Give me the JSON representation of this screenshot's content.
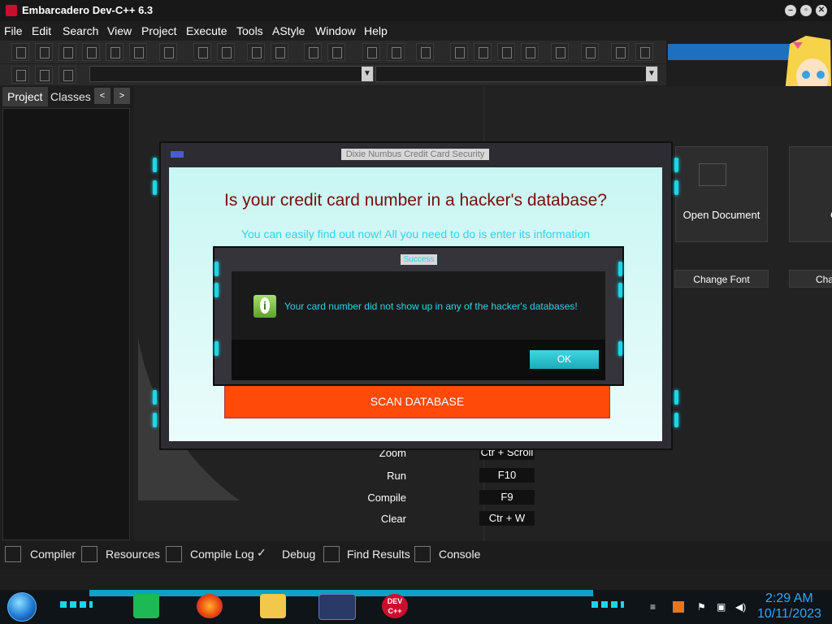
{
  "window": {
    "title": "Embarcadero Dev-C++ 6.3",
    "controls": [
      "minimize",
      "restore",
      "close"
    ]
  },
  "menu": [
    "File",
    "Edit",
    "Search",
    "View",
    "Project",
    "Execute",
    "Tools",
    "AStyle",
    "Window",
    "Help"
  ],
  "toolbar": {
    "search_value": ""
  },
  "left_tabs": {
    "project": "Project",
    "classes": "Classes",
    "prev": "<",
    "next": ">"
  },
  "welcome": {
    "open_document": "Open Document",
    "change_font": "Change Font",
    "partial_card": "C",
    "partial_button": "Cha",
    "shortcuts": [
      {
        "label": "Zoom",
        "key": "Ctr + Scroll"
      },
      {
        "label": "Run",
        "key": "F10"
      },
      {
        "label": "Compile",
        "key": "F9"
      },
      {
        "label": "Clear",
        "key": "Ctr + W"
      }
    ]
  },
  "bottom_tabs": [
    "Compiler",
    "Resources",
    "Compile Log",
    "Debug",
    "Find Results",
    "Console"
  ],
  "dialog_main": {
    "title": "Dixie Numbus Credit Card Security",
    "heading": "Is your credit card number in a hacker's database?",
    "subheading": "You can easily find out now! All you need to do is enter its information",
    "scan_button": "SCAN DATABASE"
  },
  "dialog_success": {
    "title": "Success",
    "message": "Your card number did not show up in any of the hacker's databases!",
    "ok": "OK"
  },
  "taskbar": {
    "dev_app_label": "DEV C++",
    "time": "2:29 AM",
    "date": "10/11/2023"
  },
  "colors": {
    "accent_neon": "#19d7e8",
    "scan_button": "#ff4a0a",
    "heading": "#7a0b0b",
    "search_highlight": "#1f6fbf"
  }
}
